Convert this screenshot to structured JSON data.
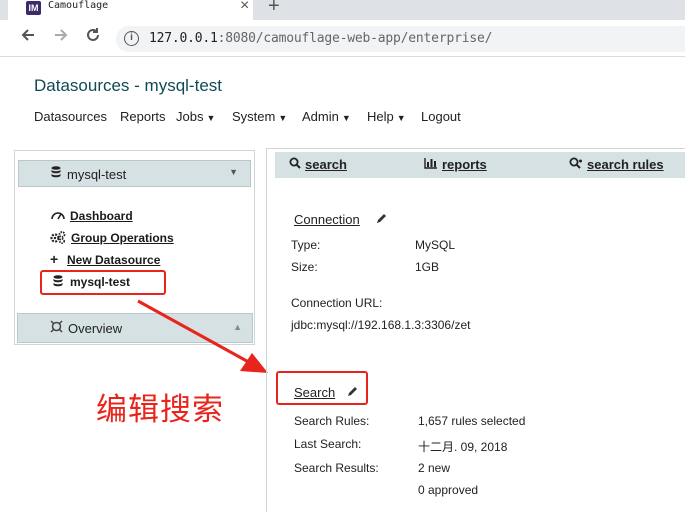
{
  "browser": {
    "tab_title": "Camouflage",
    "tab_favicon": "IM",
    "url_host": "127.0.0.1",
    "url_rest": ":8080/camouflage-web-app/enterprise/"
  },
  "app": {
    "title": "Datasources - mysql-test"
  },
  "menu": [
    {
      "label": "Datasources",
      "caret": false
    },
    {
      "label": "Reports",
      "caret": false
    },
    {
      "label": "Jobs",
      "caret": true
    },
    {
      "label": "System",
      "caret": true
    },
    {
      "label": "Admin",
      "caret": true
    },
    {
      "label": "Help",
      "caret": true
    },
    {
      "label": "Logout",
      "caret": false
    }
  ],
  "sidebar": {
    "header": "mysql-test",
    "links": {
      "dashboard": "Dashboard",
      "group_ops": "Group Operations",
      "new_ds": "New Datasource",
      "active": "mysql-test"
    },
    "overview": "Overview"
  },
  "right_tabs": {
    "search": "search",
    "reports": "reports",
    "search_rules": "search rules"
  },
  "connection": {
    "title": "Connection",
    "type_label": "Type:",
    "type_value": "MySQL",
    "size_label": "Size:",
    "size_value": "1GB",
    "url_label": "Connection URL:",
    "url_value": "jdbc:mysql://192.168.1.3:3306/zet"
  },
  "search": {
    "title": "Search",
    "rules_label": "Search Rules:",
    "rules_value": "1,657 rules selected",
    "last_label": "Last Search:",
    "last_value": "十二月. 09, 2018",
    "results_label": "Search Results:",
    "results_new": "2 new",
    "results_approved": "0 approved"
  },
  "annotation": {
    "text": "编辑搜索",
    "color": "#e8251c"
  },
  "colors": {
    "title": "#0f4a57",
    "panel_header": "#d5e1e3",
    "highlight": "#e8251c"
  }
}
